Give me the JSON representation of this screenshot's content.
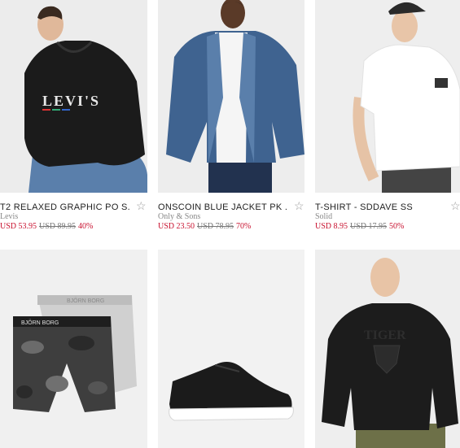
{
  "products": [
    {
      "title": "T2 RELAXED GRAPHIC PO S...",
      "brand": "Levis",
      "price": "USD 53.95",
      "old_price": "USD 89.95",
      "discount": "40%",
      "favorite_icon": "star-outline-icon"
    },
    {
      "title": "ONSCOIN BLUE JACKET PK ...",
      "brand": "Only & Sons",
      "price": "USD 23.50",
      "old_price": "USD 78.95",
      "discount": "70%",
      "favorite_icon": "star-outline-icon"
    },
    {
      "title": "T-SHIRT - SDDAVE SS",
      "brand": "Solid",
      "price": "USD 8.95",
      "old_price": "USD 17.95",
      "discount": "50%",
      "favorite_icon": "star-outline-icon"
    },
    {
      "title": "",
      "brand": "",
      "price": "",
      "old_price": "",
      "discount": ""
    },
    {
      "title": "",
      "brand": "",
      "price": "",
      "old_price": "",
      "discount": ""
    },
    {
      "title": "",
      "brand": "",
      "price": "",
      "old_price": "",
      "discount": ""
    }
  ],
  "hoodie_print": "LEVI'S",
  "boxer_band": "BJÖRN BORG",
  "sweatshirt_print": "TIGER",
  "colors": {
    "sale": "#c8102e",
    "image_bg": "#efefef"
  }
}
